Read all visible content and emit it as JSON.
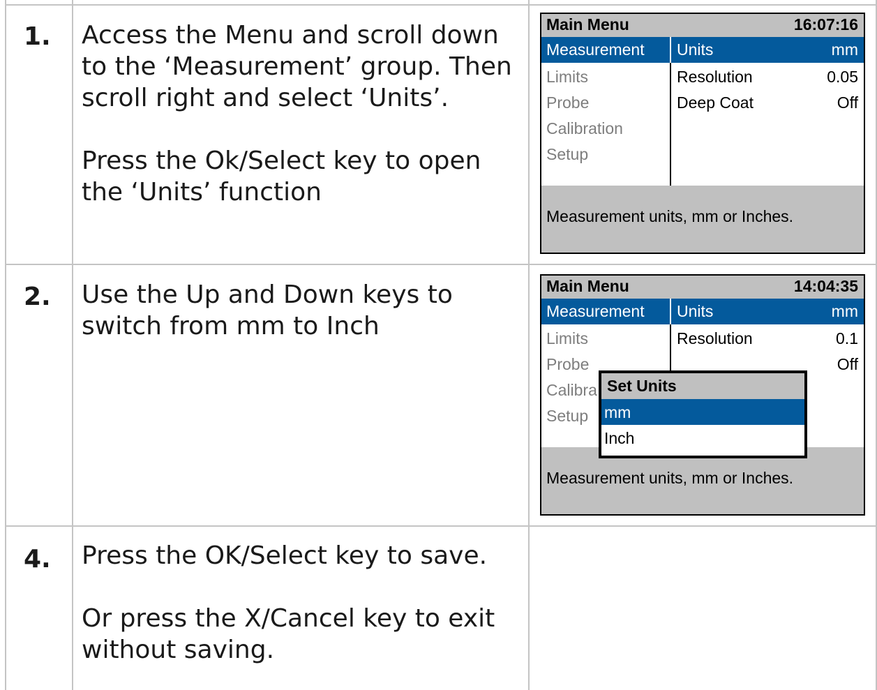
{
  "steps": [
    {
      "number": "1.",
      "text": [
        "Access the Menu and scroll down to the ‘Measurement’ group. Then scroll right and select ‘Units’.",
        "Press the Ok/Select key to open the ‘Units’ function"
      ],
      "screen": {
        "title": "Main Menu",
        "clock": "16:07:16",
        "groups": [
          "Measurement",
          "Limits",
          "Probe",
          "Calibration",
          "Setup"
        ],
        "items": [
          {
            "label": "Units",
            "value": "mm"
          },
          {
            "label": "Resolution",
            "value": "0.05"
          },
          {
            "label": "Deep Coat",
            "value": "Off"
          }
        ],
        "help": "Measurement units, mm or Inches."
      }
    },
    {
      "number": "2.",
      "text": [
        "Use the Up and Down keys to switch from mm to Inch"
      ],
      "screen": {
        "title": "Main Menu",
        "clock": "14:04:35",
        "groups": [
          "Measurement",
          "Limits",
          "Probe",
          "Calibra",
          "Setup"
        ],
        "items": [
          {
            "label": "Units",
            "value": "mm"
          },
          {
            "label": "Resolution",
            "value": "0.1"
          },
          {
            "label": "",
            "value": "Off"
          }
        ],
        "popup": {
          "title": "Set Units",
          "options": [
            "mm",
            "Inch"
          ],
          "selected": "mm"
        },
        "help": "Measurement units, mm or Inches."
      }
    },
    {
      "number": "4.",
      "text": [
        "Press the OK/Select key to save.",
        "Or press the X/Cancel key to exit without saving."
      ]
    }
  ],
  "colors": {
    "highlight": "#045a9c",
    "title_bar": "#c0c0c0",
    "grid": "#c4c4c4",
    "disabled": "#7e7e7e"
  }
}
